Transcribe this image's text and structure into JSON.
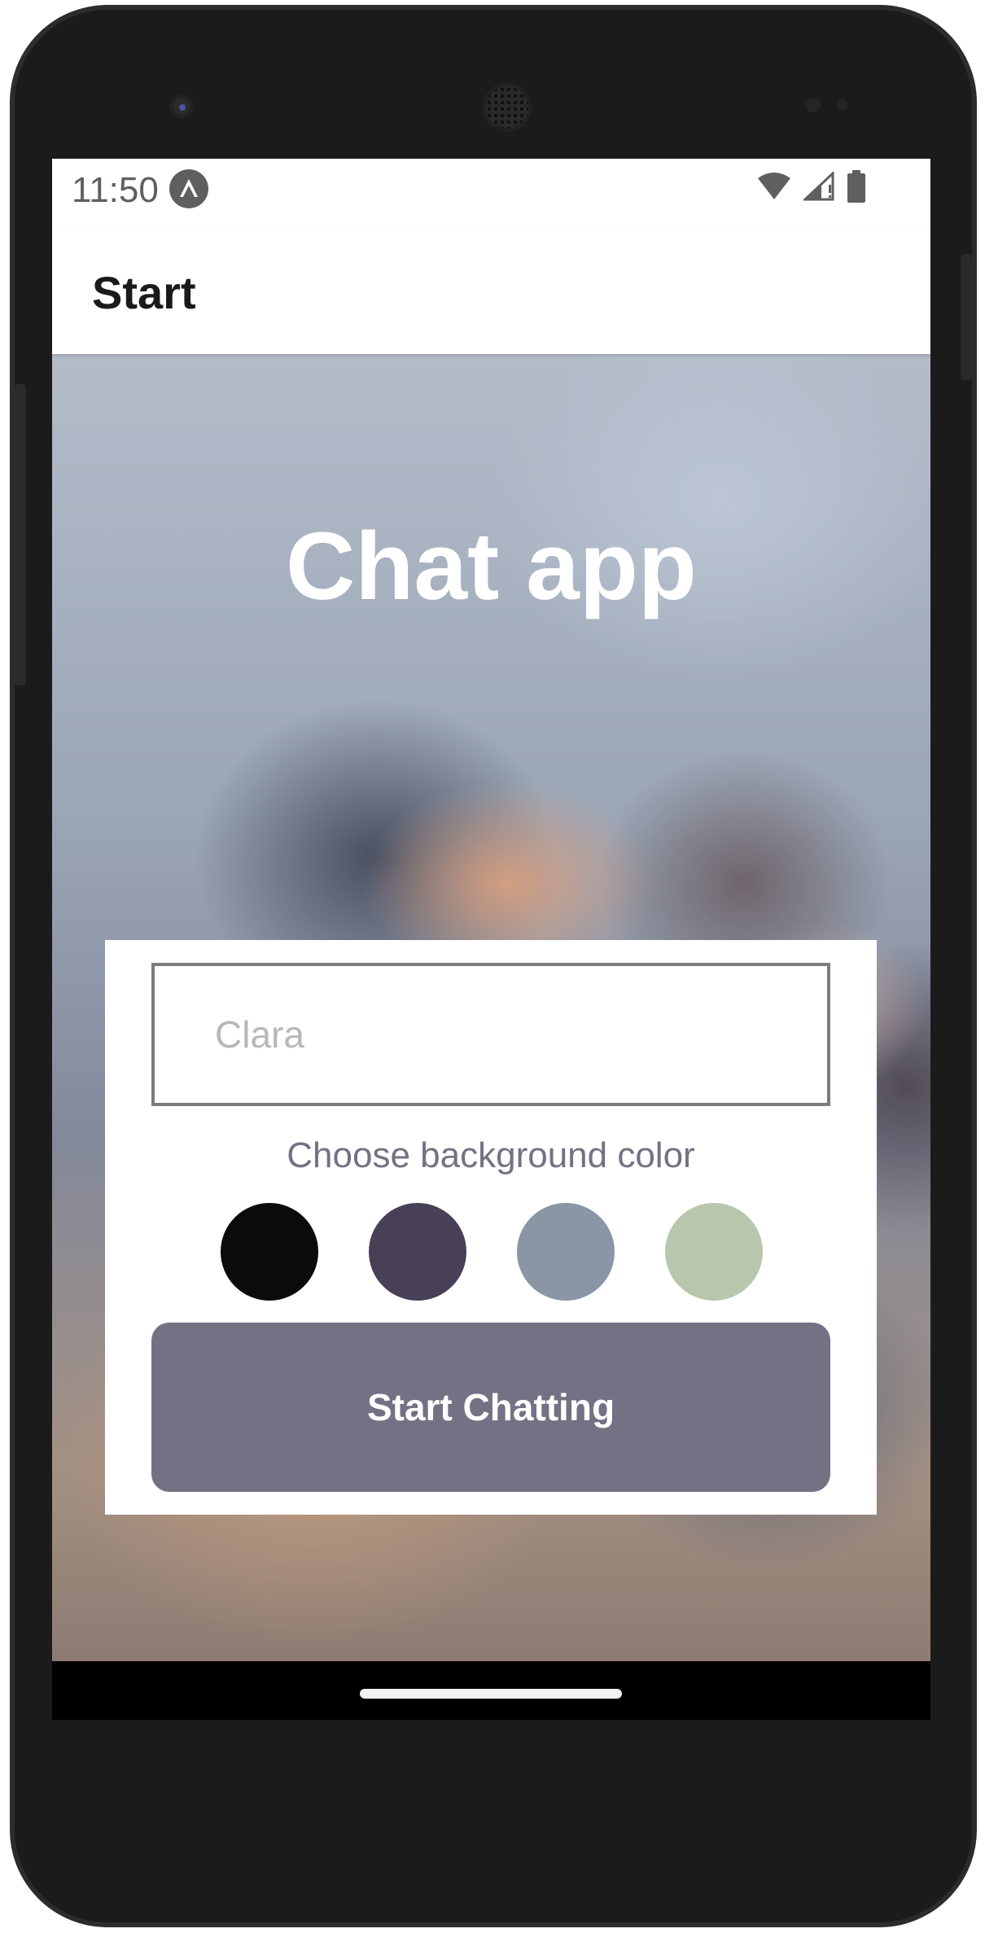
{
  "status_bar": {
    "time": "11:50",
    "app_icon": "expo-logo-icon",
    "icons": [
      "wifi-icon",
      "signal-icon",
      "battery-icon"
    ]
  },
  "app_bar": {
    "title": "Start"
  },
  "hero": {
    "title": "Chat app"
  },
  "form": {
    "name_placeholder": "Clara",
    "name_value": "",
    "color_label": "Choose background color",
    "colors": [
      {
        "name": "black-swatch",
        "hex": "#090C08"
      },
      {
        "name": "purple-swatch",
        "hex": "#474056"
      },
      {
        "name": "blue-gray-swatch",
        "hex": "#8A95A5"
      },
      {
        "name": "green-swatch",
        "hex": "#B9C6AE"
      }
    ],
    "button_label": "Start Chatting",
    "button_color": "#757083"
  },
  "colors": {
    "text_muted": "#757083",
    "white": "#FFFFFF"
  }
}
